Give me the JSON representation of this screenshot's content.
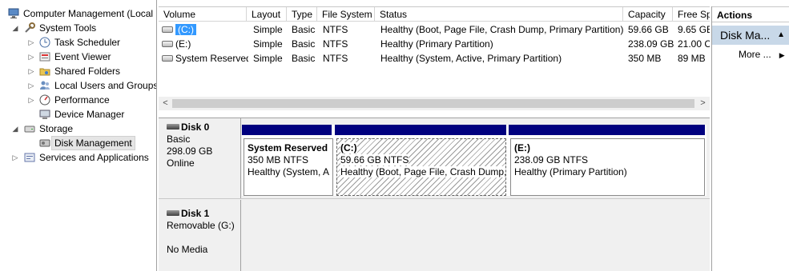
{
  "tree": {
    "root": "Computer Management (Local",
    "system_tools": "System Tools",
    "task_scheduler": "Task Scheduler",
    "event_viewer": "Event Viewer",
    "shared_folders": "Shared Folders",
    "local_users": "Local Users and Groups",
    "performance": "Performance",
    "device_manager": "Device Manager",
    "storage": "Storage",
    "disk_management": "Disk Management",
    "services": "Services and Applications"
  },
  "volume_list": {
    "headers": [
      "Volume",
      "Layout",
      "Type",
      "File System",
      "Status",
      "Capacity",
      "Free Sp"
    ],
    "rows": [
      {
        "volume": "(C:)",
        "layout": "Simple",
        "type": "Basic",
        "fs": "NTFS",
        "status": "Healthy (Boot, Page File, Crash Dump, Primary Partition)",
        "capacity": "59.66 GB",
        "free": "9.65 GE"
      },
      {
        "volume": "(E:)",
        "layout": "Simple",
        "type": "Basic",
        "fs": "NTFS",
        "status": "Healthy (Primary Partition)",
        "capacity": "238.09 GB",
        "free": "21.00 C"
      },
      {
        "volume": "System Reserved",
        "layout": "Simple",
        "type": "Basic",
        "fs": "NTFS",
        "status": "Healthy (System, Active, Primary Partition)",
        "capacity": "350 MB",
        "free": "89 MB"
      }
    ]
  },
  "scrollbar": {
    "left": "<",
    "right": ">"
  },
  "disks": {
    "disk0": {
      "name": "Disk 0",
      "type": "Basic",
      "size": "298.09 GB",
      "state": "Online"
    },
    "disk1": {
      "name": "Disk 1",
      "type": "Removable (G:)",
      "state": "No Media"
    }
  },
  "partitions": [
    {
      "name": "System Reserved",
      "size_fs": "350 MB NTFS",
      "status": "Healthy (System, A"
    },
    {
      "name": "(C:)",
      "size_fs": "59.66 GB NTFS",
      "status": "Healthy (Boot, Page File, Crash Dump,"
    },
    {
      "name": "(E:)",
      "size_fs": "238.09 GB NTFS",
      "status": "Healthy (Primary Partition)"
    }
  ],
  "actions": {
    "header": "Actions",
    "section": "Disk Ma...",
    "more": "More ..."
  },
  "colors": {
    "partition_bar": "#00007f",
    "selection": "#3399ff",
    "action_section_bg": "#c8d8e8"
  }
}
